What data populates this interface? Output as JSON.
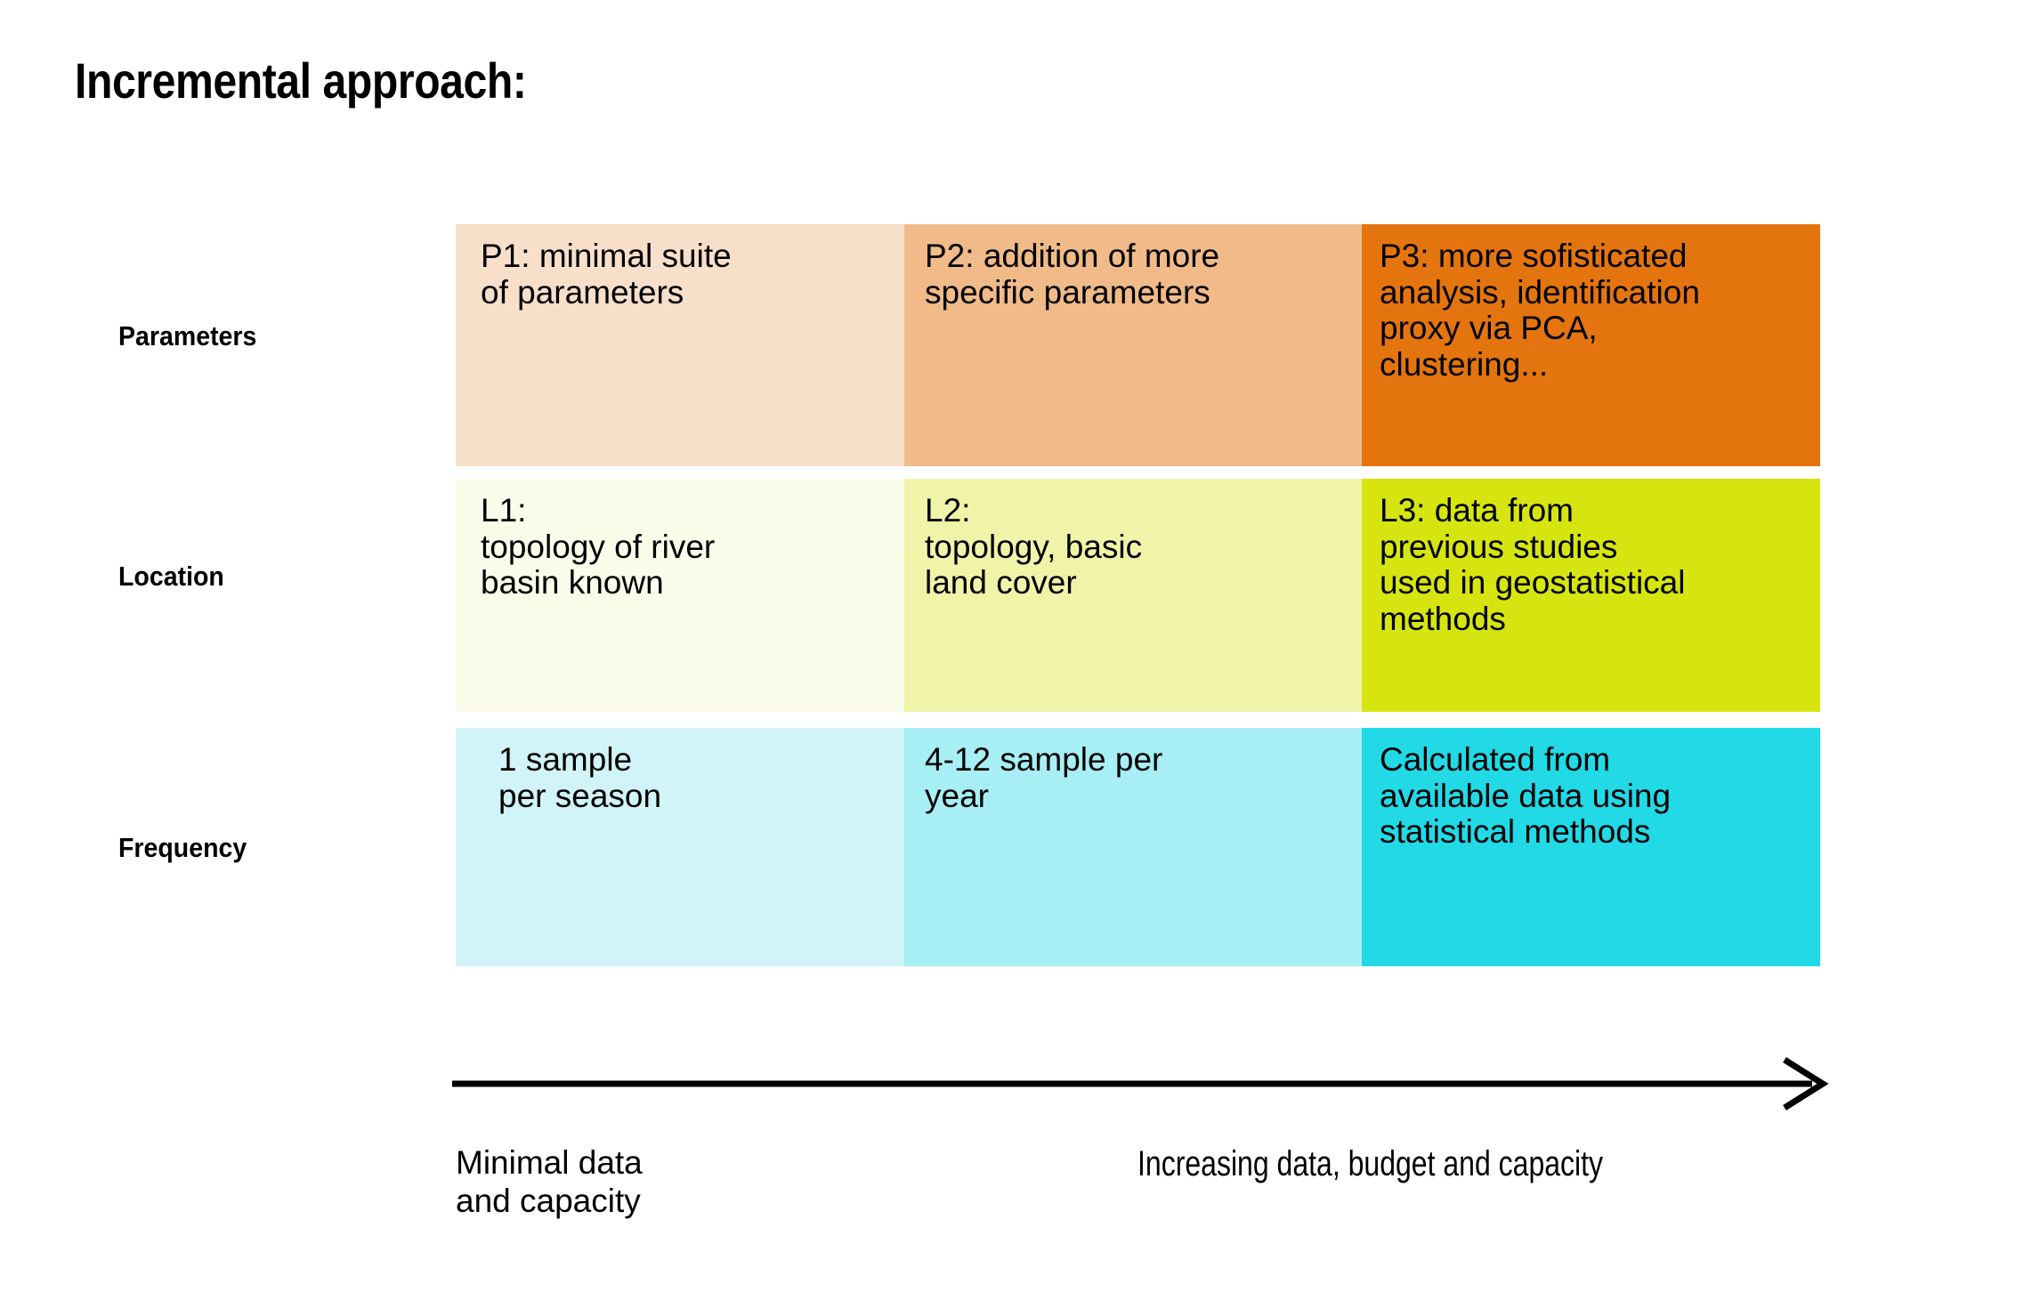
{
  "title": "Incremental approach:",
  "matrix": {
    "row_labels": [
      "Parameters",
      "Location",
      "Frequency"
    ],
    "rows": [
      {
        "name": "Parameters",
        "cells": [
          {
            "id": "P1",
            "text": "P1: minimal suite\nof parameters",
            "color": "#f8dfca"
          },
          {
            "id": "P2",
            "text": "P2: addition of more\nspecific parameters",
            "color": "#f0bb88"
          },
          {
            "id": "P3",
            "text": "P3: more sofisticated\nanalysis, identification\nproxy via PCA,\nclustering...",
            "color": "#e4750e"
          }
        ]
      },
      {
        "name": "Location",
        "cells": [
          {
            "id": "L1",
            "text": "L1:\ntopology of river\nbasin known",
            "color": "#fafce9"
          },
          {
            "id": "L2",
            "text": "L2:\ntopology, basic\nland cover",
            "color": "#eff4a8"
          },
          {
            "id": "L3",
            "text": "L3: data from\nprevious studies\nused in geostatistical\nmethods",
            "color": "#d6e510"
          }
        ]
      },
      {
        "name": "Frequency",
        "cells": [
          {
            "id": "F1",
            "text": "1 sample\nper season",
            "color": "#d1f4f8"
          },
          {
            "id": "F2",
            "text": "4-12 sample per\nyear",
            "color": "#a7eff4"
          },
          {
            "id": "F3",
            "text": "Calculated from\navailable data using\nstatistical methods",
            "color": "#22d9e6"
          }
        ]
      }
    ]
  },
  "axis": {
    "caption_left": "Minimal data\nand capacity",
    "caption_right": "Increasing data, budget and capacity",
    "arrow_color": "#000000"
  }
}
